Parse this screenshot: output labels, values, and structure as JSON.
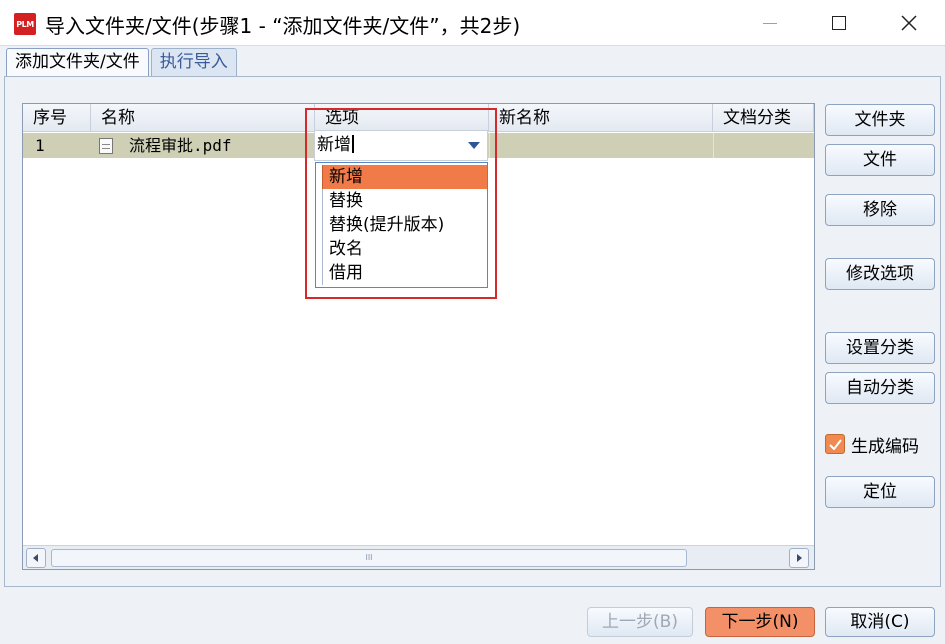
{
  "window": {
    "icon_text": "PLM",
    "title": "导入文件夹/文件(步骤1 - “添加文件夹/文件”，共2步)",
    "close_symbol": "✕"
  },
  "tabs": [
    {
      "label": "添加文件夹/文件",
      "active": true
    },
    {
      "label": "执行导入",
      "active": false
    }
  ],
  "table": {
    "columns": [
      "序号",
      "名称",
      "选项",
      "新名称",
      "文档分类"
    ],
    "rows": [
      {
        "index": "1",
        "name": "流程审批.pdf",
        "option": "新增",
        "new_name": "",
        "category": ""
      }
    ],
    "scroll_thumb_grip": "III"
  },
  "option_combo": {
    "value": "新增",
    "options": [
      "新增",
      "替换",
      "替换(提升版本)",
      "改名",
      "借用"
    ],
    "selected_index": 0
  },
  "side_buttons": {
    "folder": "文件夹",
    "file": "文件",
    "remove": "移除",
    "modify_option": "修改选项",
    "set_category": "设置分类",
    "auto_category": "自动分类",
    "locate": "定位"
  },
  "generate_code": {
    "label": "生成编码",
    "checked": true
  },
  "footer": {
    "prev": "上一步(B)",
    "next": "下一步(N)",
    "cancel": "取消(C)"
  },
  "colors": {
    "accent": "#f07a48",
    "highlight_border": "#d42a2a",
    "selected_row": "#cfcfb5"
  }
}
